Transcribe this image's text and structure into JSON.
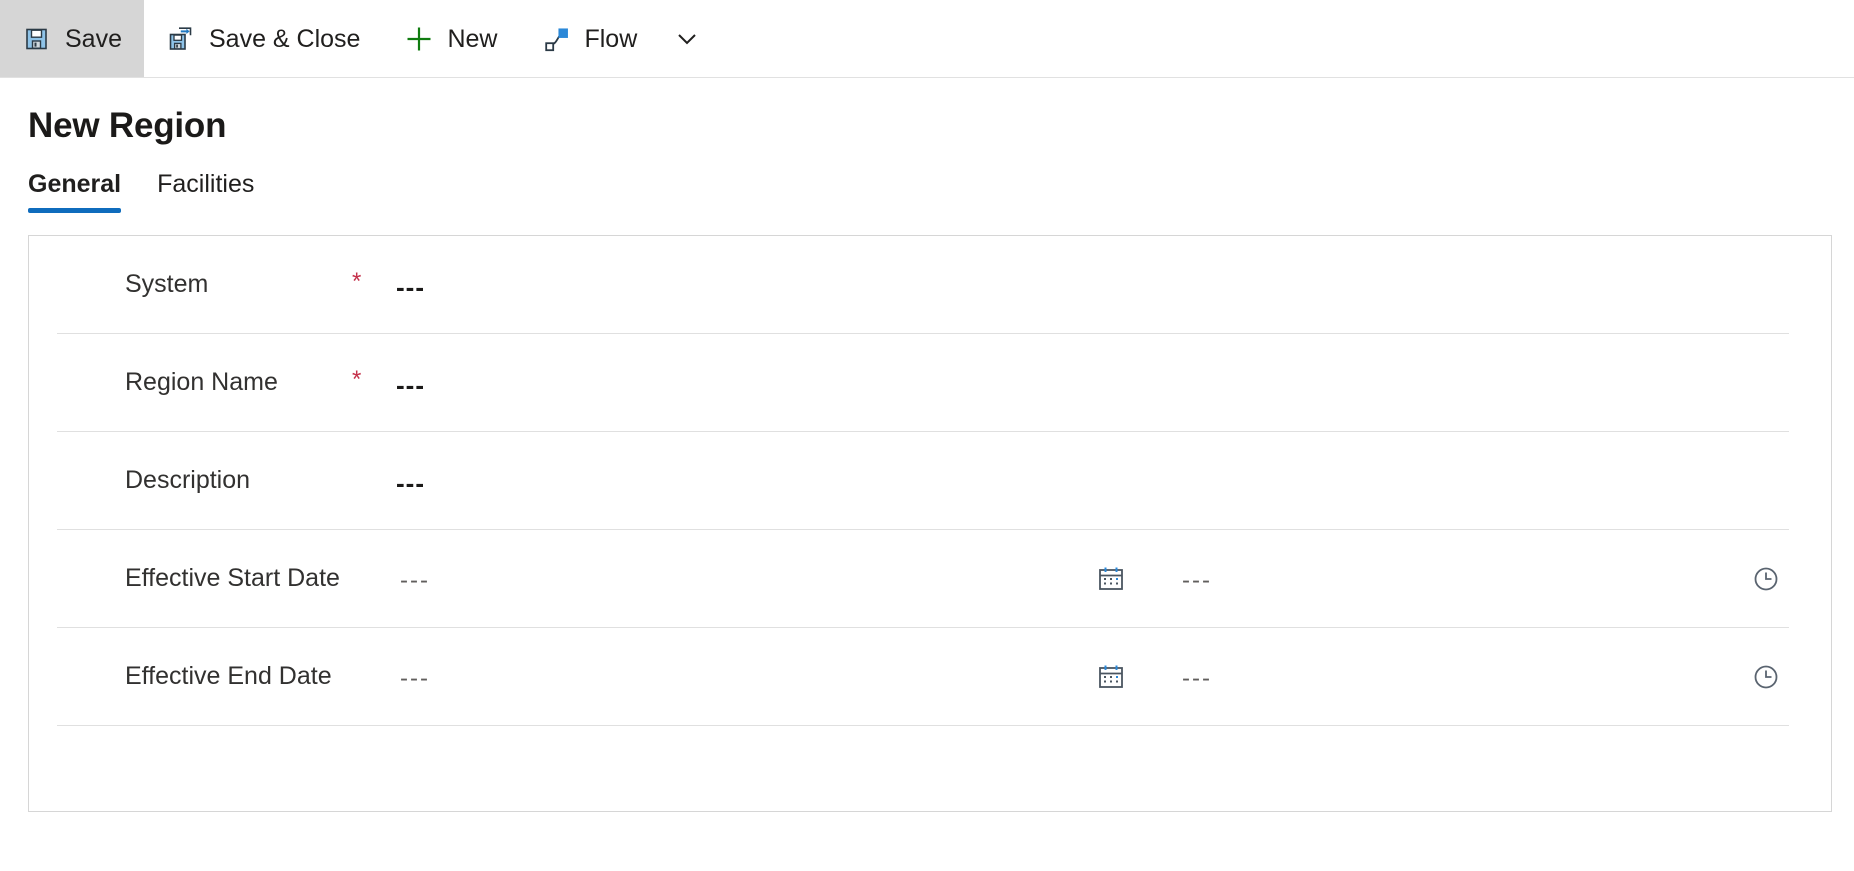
{
  "command_bar": {
    "buttons": [
      {
        "label": "Save",
        "icon": "save-floppy-icon",
        "active": true
      },
      {
        "label": "Save & Close",
        "icon": "save-and-close-icon",
        "active": false
      },
      {
        "label": "New",
        "icon": "plus-icon",
        "active": false
      },
      {
        "label": "Flow",
        "icon": "flow-icon",
        "active": false
      }
    ],
    "overflow_icon": "chevron-down-icon"
  },
  "page": {
    "title": "New Region"
  },
  "tabs": [
    {
      "label": "General",
      "selected": true
    },
    {
      "label": "Facilities",
      "selected": false
    }
  ],
  "form": {
    "rows": [
      {
        "label": "System",
        "required": true,
        "required_mark": "*",
        "value": "---",
        "type": "lookup"
      },
      {
        "label": "Region Name",
        "required": true,
        "required_mark": "*",
        "value": "---",
        "type": "text"
      },
      {
        "label": "Description",
        "required": false,
        "required_mark": "*",
        "value": "---",
        "type": "text"
      },
      {
        "label": "Effective Start Date",
        "required": false,
        "required_mark": "*",
        "value": "---",
        "time_value": "---",
        "type": "datetime",
        "date_icon": "calendar-icon",
        "time_icon": "clock-icon"
      },
      {
        "label": "Effective End Date",
        "required": false,
        "required_mark": "*",
        "value": "---",
        "time_value": "---",
        "type": "datetime",
        "date_icon": "calendar-icon",
        "time_icon": "clock-icon"
      }
    ]
  },
  "colors": {
    "accent": "#0f6cbd",
    "required": "#c4314b",
    "icon_blue": "#2b88d8",
    "icon_green": "#107c10",
    "border": "#d6d6d6",
    "divider": "#e0e0e0",
    "active_button_bg": "#d6d6d6"
  }
}
